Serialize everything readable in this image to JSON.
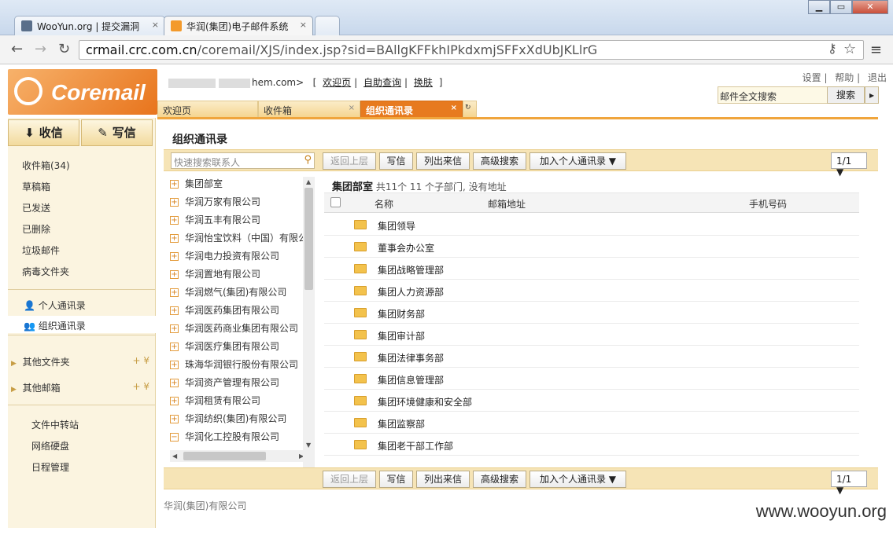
{
  "browser": {
    "tabs": [
      {
        "label": "WooYun.org | 提交漏洞"
      },
      {
        "label": "华润(集团)电子邮件系统"
      }
    ],
    "url_host": "crmail.crc.com.cn",
    "url_path": "/coremail/XJS/index.jsp?sid=BAllgKFFkhIPkdxmjSFFxXdUbJKLlrG"
  },
  "header": {
    "logo": "Coremail",
    "user_left": "[",
    "user_email": "hem.com>",
    "links": [
      "欢迎页",
      "自助查询",
      "换肤"
    ],
    "user_right": "]",
    "top_links": [
      "设置",
      "帮助",
      "退出"
    ],
    "fulltext_placeholder": "邮件全文搜索",
    "fulltext_btn": "搜索"
  },
  "content_tabs": [
    {
      "label": "欢迎页"
    },
    {
      "label": "收件箱"
    },
    {
      "label": "组织通讯录"
    }
  ],
  "sidebar": {
    "receive": "收信",
    "compose": "写信",
    "folders": [
      "收件箱(34)",
      "草稿箱",
      "已发送",
      "已删除",
      "垃圾邮件",
      "病毒文件夹"
    ],
    "personal_contacts": "个人通讯录",
    "org_contacts": "组织通讯录",
    "other_folders": "其他文件夹",
    "other_mailboxes": "其他邮箱",
    "tools": [
      "文件中转站",
      "网络硬盘",
      "日程管理"
    ]
  },
  "main": {
    "title": "组织通讯录",
    "search_placeholder": "快速搜索联系人",
    "buttons": {
      "up": "返回上层",
      "write": "写信",
      "list": "列出来信",
      "adv": "高级搜索",
      "add": "加入个人通讯录 ▼"
    },
    "pager": "1/1 ▼",
    "tree": [
      "集团部室",
      "华润万家有限公司",
      "华润五丰有限公司",
      "华润怡宝饮料（中国）有限公司",
      "华润电力投资有限公司",
      "华润置地有限公司",
      "华润燃气(集团)有限公司",
      "华润医药集团有限公司",
      "华润医药商业集团有限公司",
      "华润医疗集团有限公司",
      "珠海华润银行股份有限公司",
      "华润资产管理有限公司",
      "华润租赁有限公司",
      "华润纺织(集团)有限公司",
      "华润化工控股有限公司"
    ],
    "group_name": "集团部室",
    "group_info": "共11个 11 个子部门, 没有地址",
    "columns": {
      "name": "名称",
      "email": "邮箱地址",
      "phone": "手机号码"
    },
    "rows": [
      "集团领导",
      "董事会办公室",
      "集团战略管理部",
      "集团人力资源部",
      "集团财务部",
      "集团审计部",
      "集团法律事务部",
      "集团信息管理部",
      "集团环境健康和安全部",
      "集团监察部",
      "集团老干部工作部"
    ]
  },
  "footer": "华润(集团)有限公司",
  "watermark": "www.wooyun.org"
}
